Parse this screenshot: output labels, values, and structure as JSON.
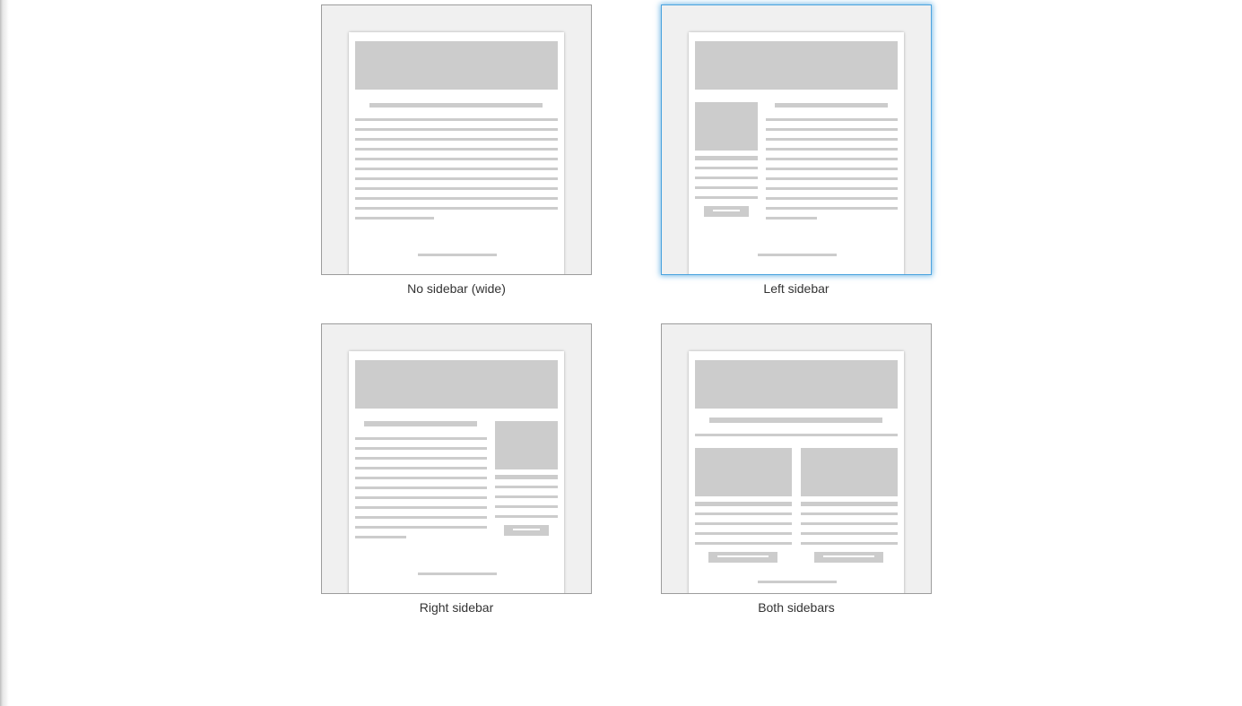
{
  "layout_options": [
    {
      "id": "no-sidebar",
      "label": "No sidebar (wide)",
      "selected": false
    },
    {
      "id": "left-sidebar",
      "label": "Left sidebar",
      "selected": true
    },
    {
      "id": "right-sidebar",
      "label": "Right sidebar",
      "selected": false
    },
    {
      "id": "both-sidebars",
      "label": "Both sidebars",
      "selected": false
    }
  ],
  "colors": {
    "selection_accent": "#4aa3df",
    "placeholder_block": "#cccccc",
    "thumbnail_background": "#f0f0f0"
  }
}
